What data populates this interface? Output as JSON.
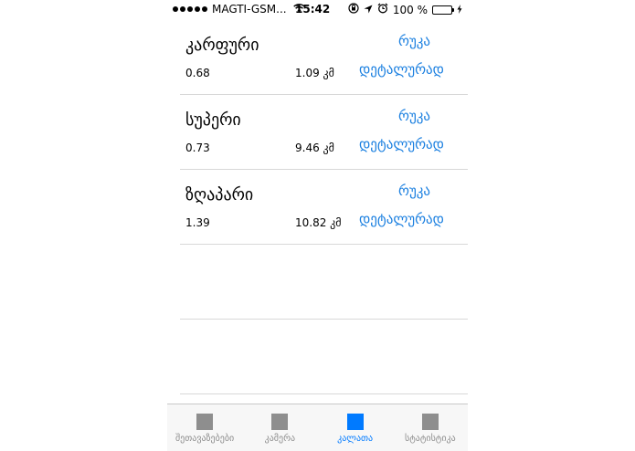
{
  "status_bar": {
    "carrier": "MAGTI-GSM...",
    "time": "15:42",
    "battery": "100 %",
    "battery_level": 1.0
  },
  "places": [
    {
      "name": "კარფური",
      "rating": "0.68",
      "distance": "1.09 კმ",
      "map_label": "რუკა",
      "details_label": "დეტალურად"
    },
    {
      "name": "სუპერი",
      "rating": "0.73",
      "distance": "9.46 კმ",
      "map_label": "რუკა",
      "details_label": "დეტალურად"
    },
    {
      "name": "ზღაპარი",
      "rating": "1.39",
      "distance": "10.82 კმ",
      "map_label": "რუკა",
      "details_label": "დეტალურად"
    }
  ],
  "tabs": [
    {
      "label": "შეთავაზებები",
      "active": false
    },
    {
      "label": "კამერა",
      "active": false
    },
    {
      "label": "კალათა",
      "active": true
    },
    {
      "label": "სტატისტიკა",
      "active": false
    }
  ],
  "colors": {
    "accent": "#007aff",
    "link": "#1a7fe0",
    "battery": "#4cd964",
    "inactive_icon": "#8e8e8e"
  }
}
